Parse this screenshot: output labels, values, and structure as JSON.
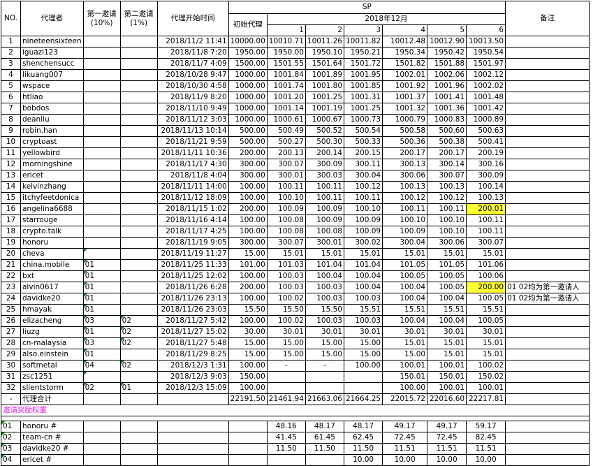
{
  "headers": {
    "no": "NO.",
    "agent": "代理者",
    "inv1": "第一邀请",
    "inv1_pct": "(10%)",
    "inv2": "第二邀请",
    "inv2_pct": "(1%)",
    "start_time": "代理开始时间",
    "sp": "SP",
    "initial": "初始代理",
    "month": "2018年12月",
    "days": [
      "1",
      "2",
      "3",
      "4",
      "5",
      "6"
    ],
    "remark": "备注"
  },
  "rows": [
    {
      "no": "1",
      "name": "nineteensixteen",
      "inv1": "",
      "inv2": "",
      "time": "2018/11/2 11:41",
      "init": "10000.00",
      "d": [
        "10010.71",
        "10011.26",
        "10011.82",
        "10012.48",
        "10012.90",
        "10013.50"
      ],
      "note": ""
    },
    {
      "no": "2",
      "name": "iguazi123",
      "inv1": "",
      "inv2": "",
      "time": "2018/11/8 7:20",
      "init": "1950.00",
      "d": [
        "1950.00",
        "1950.10",
        "1950.21",
        "1950.34",
        "1950.42",
        "1950.54"
      ],
      "note": ""
    },
    {
      "no": "3",
      "name": "shenchensucc",
      "inv1": "",
      "inv2": "",
      "time": "2018/11/7 4:09",
      "init": "1500.00",
      "d": [
        "1501.55",
        "1501.64",
        "1501.72",
        "1501.82",
        "1501.88",
        "1501.97"
      ],
      "note": ""
    },
    {
      "no": "4",
      "name": "likuang007",
      "inv1": "",
      "inv2": "",
      "time": "2018/10/28 9:47",
      "init": "1000.00",
      "d": [
        "1001.84",
        "1001.89",
        "1001.95",
        "1002.01",
        "1002.06",
        "1002.12"
      ],
      "note": ""
    },
    {
      "no": "5",
      "name": "wspace",
      "inv1": "",
      "inv2": "",
      "time": "2018/10/30 4:58",
      "init": "1000.00",
      "d": [
        "1001.74",
        "1001.80",
        "1001.85",
        "1001.92",
        "1001.96",
        "1002.02"
      ],
      "note": ""
    },
    {
      "no": "6",
      "name": "htliao",
      "inv1": "",
      "inv2": "",
      "time": "2018/11/9 8:20",
      "init": "1000.00",
      "d": [
        "1001.20",
        "1001.25",
        "1001.31",
        "1001.37",
        "1001.41",
        "1001.48"
      ],
      "note": ""
    },
    {
      "no": "7",
      "name": "bobdos",
      "inv1": "",
      "inv2": "",
      "time": "2018/11/10 9:49",
      "init": "1000.00",
      "d": [
        "1001.14",
        "1001.19",
        "1001.25",
        "1001.32",
        "1001.36",
        "1001.42"
      ],
      "note": ""
    },
    {
      "no": "8",
      "name": "deanliu",
      "inv1": "",
      "inv2": "",
      "time": "2018/11/12 3:03",
      "init": "1000.00",
      "d": [
        "1000.61",
        "1000.67",
        "1000.73",
        "1000.79",
        "1000.83",
        "1000.89"
      ],
      "note": ""
    },
    {
      "no": "9",
      "name": "robin.han",
      "inv1": "",
      "inv2": "",
      "time": "2018/11/13 10:14",
      "init": "500.00",
      "d": [
        "500.49",
        "500.52",
        "500.54",
        "500.58",
        "500.60",
        "500.63"
      ],
      "note": ""
    },
    {
      "no": "10",
      "name": "cryptoast",
      "inv1": "",
      "inv2": "",
      "time": "2018/11/21 9:59",
      "init": "500.00",
      "d": [
        "500.27",
        "500.30",
        "500.33",
        "500.36",
        "500.38",
        "500.41"
      ],
      "note": ""
    },
    {
      "no": "11",
      "name": "yellowbird",
      "inv1": "",
      "inv2": "",
      "time": "2018/11/11 10:36",
      "init": "200.00",
      "d": [
        "200.13",
        "200.14",
        "200.15",
        "200.17",
        "200.17",
        "200.19"
      ],
      "note": ""
    },
    {
      "no": "12",
      "name": "morningshine",
      "inv1": "",
      "inv2": "",
      "time": "2018/11/17 4:30",
      "init": "300.00",
      "d": [
        "300.07",
        "300.09",
        "300.11",
        "300.13",
        "300.14",
        "300.16"
      ],
      "note": ""
    },
    {
      "no": "13",
      "name": "ericet",
      "inv1": "",
      "inv2": "",
      "time": "2018/11/8 4:04",
      "init": "300.00",
      "d": [
        "300.01",
        "300.03",
        "300.04",
        "300.06",
        "300.07",
        "300.09"
      ],
      "note": ""
    },
    {
      "no": "14",
      "name": "kelvinzhang",
      "inv1": "",
      "inv2": "",
      "time": "2018/11/11 14:00",
      "init": "100.00",
      "d": [
        "100.11",
        "100.11",
        "100.12",
        "100.13",
        "100.13",
        "100.14"
      ],
      "note": ""
    },
    {
      "no": "15",
      "name": "itchyfeetdonica",
      "inv1": "",
      "inv2": "",
      "time": "2018/11/12 18:09",
      "init": "100.00",
      "d": [
        "100.10",
        "100.11",
        "100.11",
        "100.12",
        "100.12",
        "100.13"
      ],
      "note": ""
    },
    {
      "no": "16",
      "name": "angelina6688",
      "inv1": "",
      "inv2": "",
      "time": "2018/11/15 1:02",
      "init": "200.00",
      "d": [
        "100.09",
        "100.09",
        "100.10",
        "100.11",
        "100.11",
        "200.01"
      ],
      "note": "",
      "hl": true
    },
    {
      "no": "17",
      "name": "starrouge",
      "inv1": "",
      "inv2": "",
      "time": "2018/11/16 4:14",
      "init": "100.00",
      "d": [
        "100.08",
        "100.09",
        "100.09",
        "100.10",
        "100.10",
        "100.11"
      ],
      "note": ""
    },
    {
      "no": "18",
      "name": "crypto.talk",
      "inv1": "",
      "inv2": "",
      "time": "2018/11/17 4:25",
      "init": "100.00",
      "d": [
        "100.08",
        "100.08",
        "100.09",
        "100.09",
        "100.10",
        "100.11"
      ],
      "note": ""
    },
    {
      "no": "19",
      "name": "honoru",
      "inv1": "",
      "inv2": "",
      "time": "2018/11/19 9:05",
      "init": "300.00",
      "d": [
        "300.07",
        "300.01",
        "300.02",
        "300.04",
        "300.06",
        "300.07"
      ],
      "note": ""
    },
    {
      "no": "20",
      "name": "cheva",
      "inv1": "",
      "inv2": "",
      "time": "2018/11/19 11:27",
      "init": "15.00",
      "d": [
        "15.01",
        "15.01",
        "15.01",
        "15.01",
        "15.01",
        "15.01"
      ],
      "note": "",
      "tri1": true
    },
    {
      "no": "21",
      "name": "china.mobile",
      "inv1": "01",
      "inv2": "",
      "time": "2018/11/25 11:33",
      "init": "101.00",
      "d": [
        "101.03",
        "101.04",
        "101.04",
        "101.05",
        "101.05",
        "101.06"
      ],
      "note": "",
      "tri1": true
    },
    {
      "no": "22",
      "name": "bxt",
      "inv1": "01",
      "inv2": "",
      "time": "2018/11/25 12:02",
      "init": "100.00",
      "d": [
        "100.03",
        "100.04",
        "100.04",
        "100.05",
        "100.05",
        "100.06"
      ],
      "note": "",
      "tri1": true
    },
    {
      "no": "23",
      "name": "alvin0617",
      "inv1": "01",
      "inv2": "",
      "time": "2018/11/26 6:28",
      "init": "200.00",
      "d": [
        "100.03",
        "100.03",
        "100.04",
        "100.04",
        "100.05",
        "200.00"
      ],
      "note": "01 02均为第一邀请人",
      "hl": true,
      "tri1": true
    },
    {
      "no": "24",
      "name": "davidke20",
      "inv1": "01",
      "inv2": "",
      "time": "2018/11/26 23:13",
      "init": "100.00",
      "d": [
        "100.02",
        "100.03",
        "100.03",
        "100.04",
        "100.04",
        "100.05"
      ],
      "note": "01 02均为第一邀请人",
      "tri1": true
    },
    {
      "no": "25",
      "name": "hmayak",
      "inv1": "01",
      "inv2": "",
      "time": "2018/11/26 23:03",
      "init": "15.50",
      "d": [
        "15.50",
        "15.50",
        "15.51",
        "15.51",
        "15.51",
        "15.51"
      ],
      "note": "",
      "tri1": true
    },
    {
      "no": "26",
      "name": "elizacheng",
      "inv1": "03",
      "inv2": "02",
      "time": "2018/11/27 5:42",
      "init": "100.00",
      "d": [
        "100.02",
        "100.03",
        "100.03",
        "100.04",
        "100.04",
        "100.05"
      ],
      "note": "",
      "tri1": true,
      "tri2": true
    },
    {
      "no": "27",
      "name": "liuzg",
      "inv1": "01",
      "inv2": "02",
      "time": "2018/11/27 15:02",
      "init": "30.00",
      "d": [
        "30.01",
        "30.01",
        "30.01",
        "30.01",
        "30.01",
        "30.01"
      ],
      "note": "",
      "tri1": true,
      "tri2": true
    },
    {
      "no": "28",
      "name": "cn-malaysia",
      "inv1": "03",
      "inv2": "02",
      "time": "2018/11/27 5:48",
      "init": "15.00",
      "d": [
        "15.00",
        "15.00",
        "15.00",
        "15.01",
        "15.01",
        "15.01"
      ],
      "note": "",
      "tri1": true,
      "tri2": true
    },
    {
      "no": "29",
      "name": "also.einstein",
      "inv1": "01",
      "inv2": "",
      "time": "2018/11/29 8:25",
      "init": "15.00",
      "d": [
        "15.00",
        "15.00",
        "15.00",
        "15.00",
        "15.01",
        "15.01"
      ],
      "note": "",
      "tri1": true
    },
    {
      "no": "30",
      "name": "softmetal",
      "inv1": "04",
      "inv2": "02",
      "time": "2018/12/3 1:31",
      "init": "100.00",
      "d": [
        "-",
        "-",
        "100.00",
        "100.01",
        "100.01",
        "100.02"
      ],
      "note": "",
      "tri1": true,
      "tri2": true
    },
    {
      "no": "31",
      "name": "zsc1251",
      "inv1": "",
      "inv2": "",
      "time": "2018/12/3 9:03",
      "init": "150.00",
      "d": [
        "",
        "",
        "",
        "150.01",
        "150.01",
        "150.02"
      ],
      "note": "",
      "tri1": true
    },
    {
      "no": "32",
      "name": "slientstorm",
      "inv1": "02",
      "inv2": "01",
      "time": "2018/12/3 15:09",
      "init": "100.00",
      "d": [
        "",
        "",
        "",
        "100.00",
        "100.01",
        "100.01"
      ],
      "note": "",
      "tri1": true,
      "tri2": true
    }
  ],
  "total": {
    "no": "-",
    "name": "代理合计",
    "init": "22191.50",
    "d": [
      "21461.94",
      "21663.06",
      "21664.25",
      "22015.72",
      "22016.60",
      "22217.81"
    ]
  },
  "reward_title": "邀请奖励权重",
  "rewards": [
    {
      "no": "01",
      "name": "honoru #",
      "d": [
        "48.16",
        "48.17",
        "48.17",
        "49.17",
        "49.17",
        "59.17"
      ]
    },
    {
      "no": "02",
      "name": "team-cn #",
      "d": [
        "41.45",
        "61.45",
        "62.45",
        "72.45",
        "72.45",
        "82.45"
      ]
    },
    {
      "no": "03",
      "name": "davidke20 #",
      "d": [
        "11.50",
        "11.50",
        "11.50",
        "11.51",
        "11.51",
        "11.51"
      ]
    },
    {
      "no": "04",
      "name": "ericet #",
      "d": [
        "",
        "",
        "10.00",
        "10.00",
        "10.00",
        "10.00"
      ]
    }
  ],
  "colors": {
    "highlight": "#ffff33",
    "section_title": "#e020e0",
    "comment_marker": "#1a7f2e"
  }
}
